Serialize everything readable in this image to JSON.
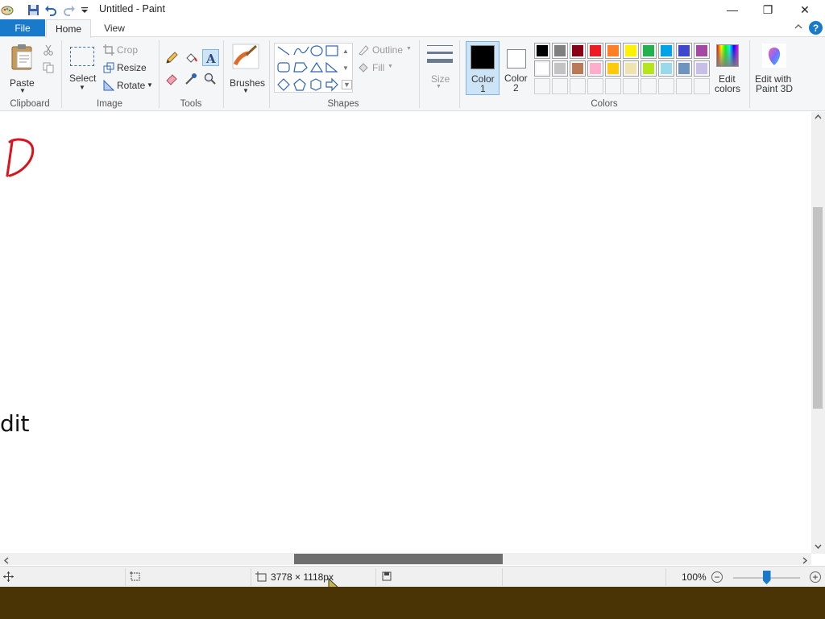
{
  "window": {
    "title": "Untitled - Paint",
    "minimize_glyph": "—",
    "maximize_glyph": "❐",
    "close_glyph": "✕"
  },
  "tabs": {
    "file": "File",
    "home": "Home",
    "view": "View"
  },
  "help": {
    "glyph": "?"
  },
  "ribbon": {
    "clipboard": {
      "paste_label": "Paste",
      "group_label": "Clipboard"
    },
    "image": {
      "select_label": "Select",
      "crop_label": "Crop",
      "resize_label": "Resize",
      "rotate_label": "Rotate",
      "group_label": "Image"
    },
    "tools": {
      "group_label": "Tools"
    },
    "brushes": {
      "label": "Brushes"
    },
    "shapes": {
      "outline_label": "Outline",
      "fill_label": "Fill",
      "group_label": "Shapes"
    },
    "size": {
      "label": "Size"
    },
    "colors": {
      "color1_label": "Color",
      "color1_num": "1",
      "color2_label": "Color",
      "color2_num": "2",
      "color1_value": "#000000",
      "color2_value": "#ffffff",
      "edit_label_1": "Edit",
      "edit_label_2": "colors",
      "paint3d_label_1": "Edit with",
      "paint3d_label_2": "Paint 3D",
      "group_label": "Colors",
      "palette_row1": [
        "#000000",
        "#7f7f7f",
        "#880015",
        "#ed1c24",
        "#ff7f27",
        "#fff200",
        "#22b14c",
        "#00a2e8",
        "#3f48cc",
        "#a349a4"
      ],
      "palette_row2": [
        "#ffffff",
        "#c3c3c3",
        "#b97a57",
        "#ffaec9",
        "#ffc90e",
        "#efe4b0",
        "#b5e61d",
        "#99d9ea",
        "#7092be",
        "#c8bfe7"
      ]
    }
  },
  "canvas": {
    "visible_text": "dit"
  },
  "status": {
    "dimensions": "3778 × 1118px",
    "zoom": "100%",
    "zoom_level_fraction": 0.5
  }
}
